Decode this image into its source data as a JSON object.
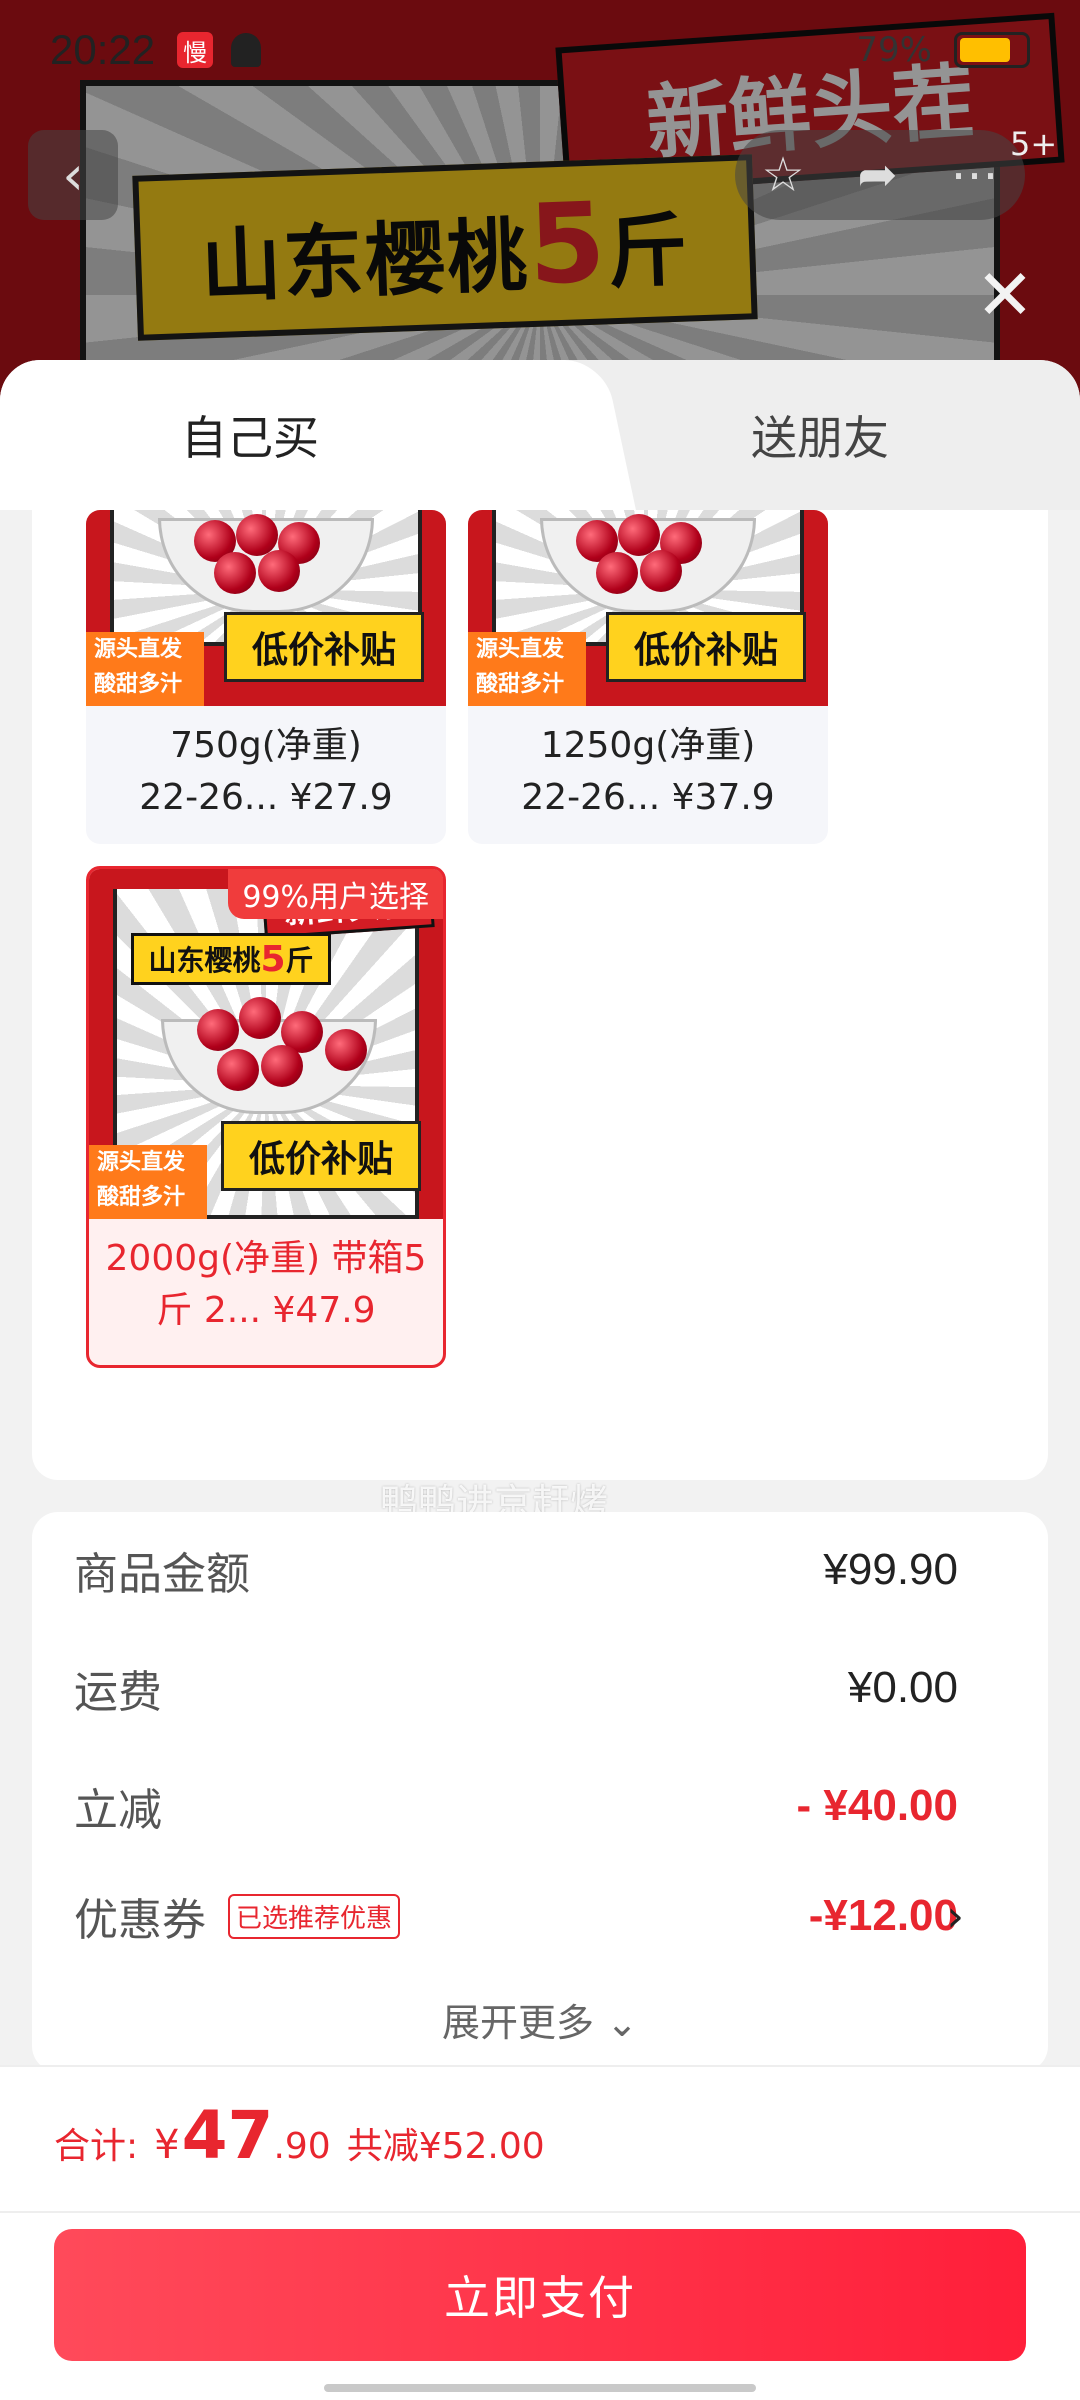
{
  "status_bar": {
    "time": "20:22",
    "app_icon_text": "慢",
    "battery_percent": "79%"
  },
  "background": {
    "hero_title_prefix": "山东樱桃",
    "hero_title_number": "5",
    "hero_title_suffix": "斤",
    "hero_stamp": "新鲜头茬",
    "share_badge": "5+"
  },
  "tabs": [
    {
      "label": "自己买"
    },
    {
      "label": "送朋友"
    }
  ],
  "sku_options": [
    {
      "line1": "750g(净重)",
      "line2": "22-26... ¥27.9",
      "tag_left_1": "源头直发",
      "tag_left_2": "酸甜多汁",
      "tag_right": "低价补贴"
    },
    {
      "line1": "1250g(净重)",
      "line2": "22-26... ¥37.9",
      "tag_left_1": "源头直发",
      "tag_left_2": "酸甜多汁",
      "tag_right": "低价补贴"
    },
    {
      "line1": "2000g(净重) 带箱5",
      "line2": "斤 2... ¥47.9",
      "hot_label": "99%用户选择",
      "stamp": "新鲜头茬",
      "title_prefix": "山东樱桃",
      "title_number": "5",
      "title_suffix": "斤",
      "tag_left_1": "源头直发",
      "tag_left_2": "酸甜多汁",
      "tag_right": "低价补贴",
      "selected": true
    }
  ],
  "watermark": "鸭鸭进京赶烤",
  "price_details": {
    "goods_amount": {
      "label": "商品金额",
      "value": "¥99.90"
    },
    "shipping": {
      "label": "运费",
      "value": "¥0.00"
    },
    "instant_discount": {
      "label": "立减",
      "value": "- ¥40.00"
    },
    "coupon": {
      "label": "优惠券",
      "chip": "已选推荐优惠",
      "value": "-¥12.00"
    },
    "expand_more": "展开更多 ⌄"
  },
  "summary": {
    "total_label": "合计:",
    "currency": "¥",
    "total_int": "47",
    "total_dec": ".90",
    "saved": "共减¥52.00"
  },
  "pay_button": "立即支付",
  "colors": {
    "accent": "#e8262f",
    "button": "#ff2a42",
    "hot_label": "#f03c3c"
  }
}
